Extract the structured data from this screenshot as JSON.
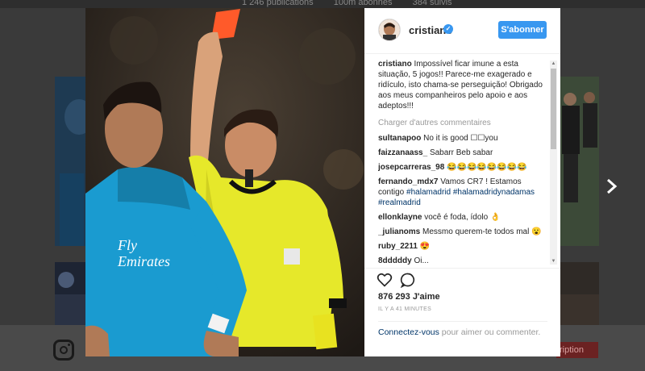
{
  "background": {
    "stats": [
      "1 246 publications",
      "100m abonnés",
      "384 suivis"
    ],
    "signup_label": "ription"
  },
  "post": {
    "username": "cristiano",
    "follow_label": "S'abonner",
    "caption_user": "cristiano",
    "caption_text": "Impossível ficar imune a esta situação, 5 jogos!! Parece-me exagerado e ridículo, isto chama-se perseguição! Obrigado aos meus companheiros pelo apoio e aos adeptos!!!",
    "load_more": "Charger d'autres commentaires",
    "comments": [
      {
        "user": "sultanapoo",
        "text": "No it is good ☐☐you"
      },
      {
        "user": "faizzanaass_",
        "text": "Sabarr Beb sabar"
      },
      {
        "user": "josepcarreras_98",
        "text": "😂😂😂😂😂😂😂😂"
      },
      {
        "user": "fernando_mdx7",
        "text": "Vamos CR7 ! Estamos contigo",
        "tags": "#halamadrid #halamadridynadamas #realmadrid"
      },
      {
        "user": "ellonklayne",
        "text": "você é foda, ídolo 👌"
      },
      {
        "user": "_julianoms",
        "text": "Messmo querem-te todos mal 😮"
      },
      {
        "user": "ruby_2211",
        "text": "😍"
      },
      {
        "user": "8dddddy",
        "text": "Oi..."
      }
    ],
    "likes": "876 293 J'aime",
    "time": "IL Y A 41 MINUTES",
    "login_link": "Connectez-vous",
    "login_text": " pour aimer ou commenter."
  },
  "icons": {
    "like": "heart-icon",
    "comment": "speech-bubble-icon",
    "next": "chevron-right-icon",
    "verified": "verified-badge-icon",
    "instagram": "instagram-logo-icon"
  },
  "colors": {
    "accent": "#3897f0",
    "link": "#003569",
    "muted": "#999999",
    "text": "#262626"
  }
}
